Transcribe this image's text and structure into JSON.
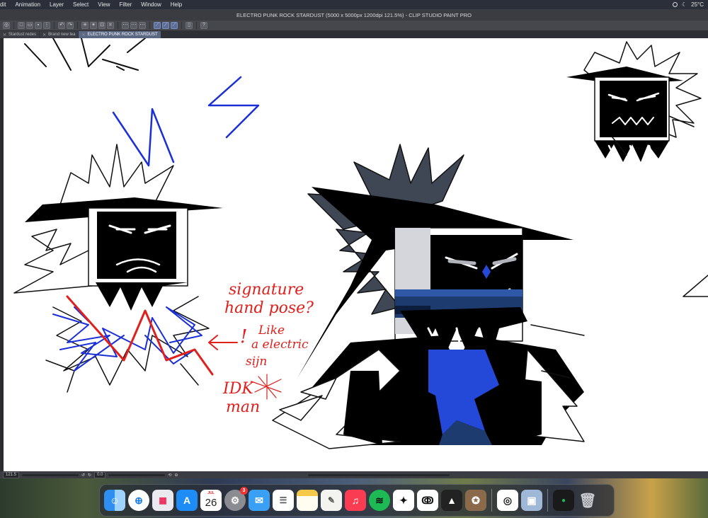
{
  "menubar": {
    "items": [
      "dit",
      "Animation",
      "Layer",
      "Select",
      "View",
      "Filter",
      "Window",
      "Help"
    ],
    "weather": "25°C"
  },
  "window": {
    "title": "ELECTRO PUNK ROCK STARDUST (5000 x 5000px 1200dpi 121.5%)  - CLIP STUDIO PAINT PRO"
  },
  "tabs": [
    {
      "label": "Stardust redes",
      "active": false
    },
    {
      "label": "Brand new lea",
      "active": false
    },
    {
      "label": "ELECTRO PUNK ROCK STARDUST",
      "active": true
    }
  ],
  "statusbar": {
    "zoom": "121.5",
    "angle": "0.0"
  },
  "annotations": {
    "line1": "signature",
    "line2": "hand pose?",
    "mark": "!",
    "note1": "Like",
    "note2": "a electric",
    "note3": "sijn",
    "idk1": "IDK",
    "idk2": "man"
  },
  "dock": {
    "calendar_month": "JUL",
    "calendar_day": "26",
    "settings_badge": "3"
  },
  "colors": {
    "accent_tab": "#5b6884",
    "annotation_red": "#e0201c",
    "sketch_blue": "#1a2fd6"
  }
}
